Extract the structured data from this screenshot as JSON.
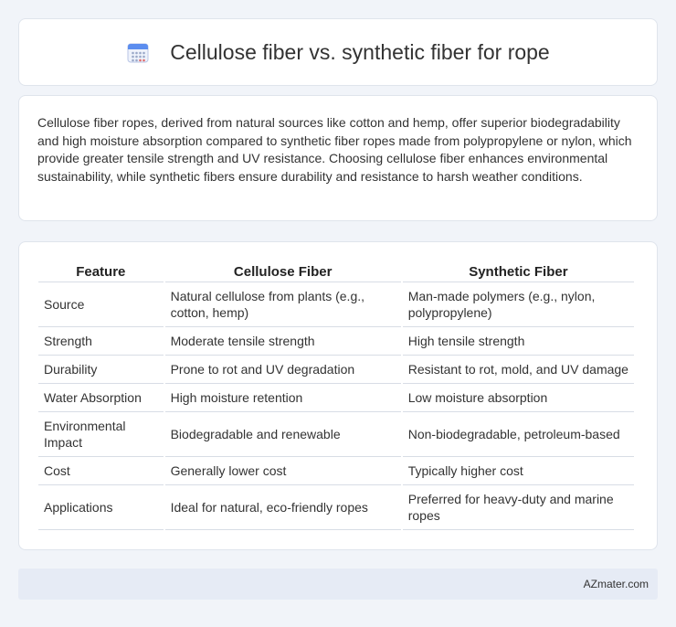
{
  "header": {
    "title": "Cellulose fiber vs. synthetic fiber for rope",
    "icon": "calendar-icon",
    "icon_color": "#5b8def"
  },
  "summary": {
    "text": "Cellulose fiber ropes, derived from natural sources like cotton and hemp, offer superior biodegradability and high moisture absorption compared to synthetic fiber ropes made from polypropylene or nylon, which provide greater tensile strength and UV resistance. Choosing cellulose fiber enhances environmental sustainability, while synthetic fibers ensure durability and resistance to harsh weather conditions."
  },
  "table": {
    "headers": [
      "Feature",
      "Cellulose Fiber",
      "Synthetic Fiber"
    ],
    "rows": [
      [
        "Source",
        "Natural cellulose from plants (e.g., cotton, hemp)",
        "Man-made polymers (e.g., nylon, polypropylene)"
      ],
      [
        "Strength",
        "Moderate tensile strength",
        "High tensile strength"
      ],
      [
        "Durability",
        "Prone to rot and UV degradation",
        "Resistant to rot, mold, and UV damage"
      ],
      [
        "Water Absorption",
        "High moisture retention",
        "Low moisture absorption"
      ],
      [
        "Environmental Impact",
        "Biodegradable and renewable",
        "Non-biodegradable, petroleum-based"
      ],
      [
        "Cost",
        "Generally lower cost",
        "Typically higher cost"
      ],
      [
        "Applications",
        "Ideal for natural, eco-friendly ropes",
        "Preferred for heavy-duty and marine ropes"
      ]
    ]
  },
  "footer": {
    "brand": "AZmater.com"
  }
}
